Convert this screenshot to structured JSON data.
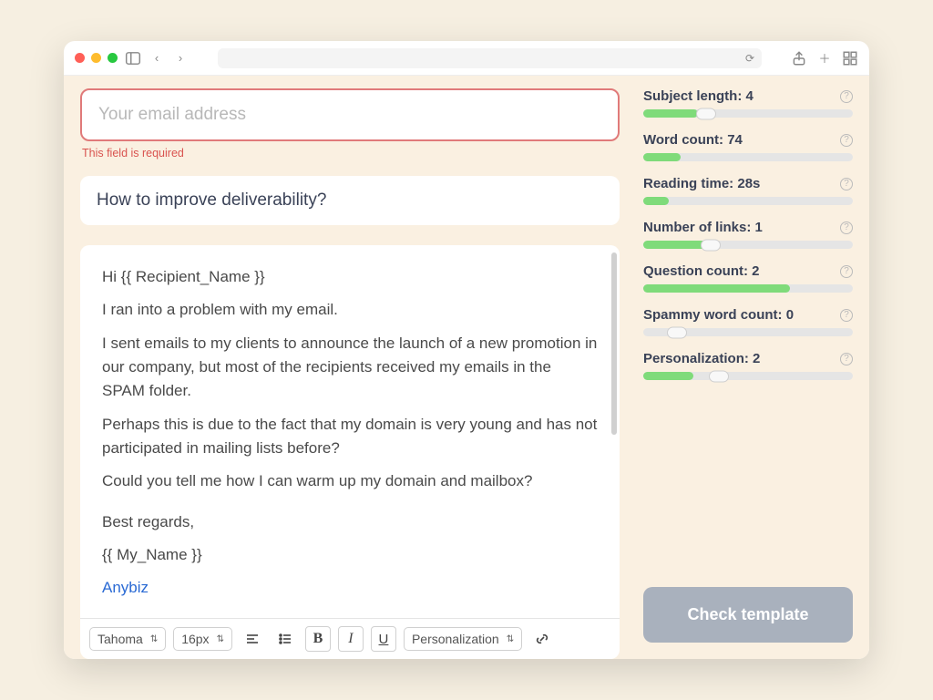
{
  "email_field": {
    "placeholder": "Your email address",
    "error": "This field is required"
  },
  "subject": "How to improve deliverability?",
  "body": {
    "p1": "Hi {{ Recipient_Name }}",
    "p2": "I ran into a problem with my email.",
    "p3": "I sent emails to my clients to announce the launch of a new promotion in our company, but most of the recipients received my emails in the SPAM folder.",
    "p4": "Perhaps this is due to the fact that my domain is very young and has not participated in mailing lists before?",
    "p5": "Could you tell me how I can warm up my domain and mailbox?",
    "p6": "Best regards,",
    "p7": "{{ My_Name }}",
    "link": "Anybiz"
  },
  "toolbar": {
    "font": "Tahoma",
    "size": "16px",
    "personalization": "Personalization"
  },
  "metrics": [
    {
      "label": "Subject length:",
      "value": "4",
      "fill": 26,
      "thumb": 30
    },
    {
      "label": "Word count:",
      "value": "74",
      "fill": 18,
      "thumb": null
    },
    {
      "label": "Reading time:",
      "value": "28s",
      "fill": 12,
      "thumb": null
    },
    {
      "label": "Number of links:",
      "value": "1",
      "fill": 32,
      "thumb": 32
    },
    {
      "label": "Question count:",
      "value": "2",
      "fill": 70,
      "thumb": null
    },
    {
      "label": "Spammy word count:",
      "value": "0",
      "fill": 0,
      "thumb": 16
    },
    {
      "label": "Personalization:",
      "value": "2",
      "fill": 24,
      "thumb": 36
    }
  ],
  "check_button": "Check template"
}
